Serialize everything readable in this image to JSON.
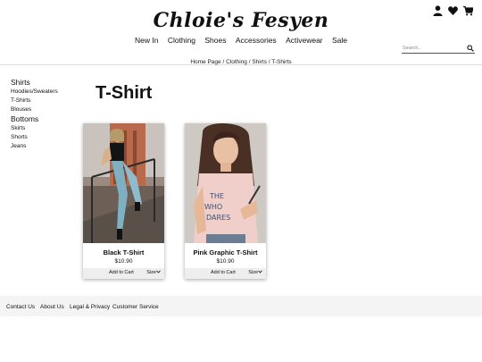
{
  "header": {
    "brand": "Chloie's Fesyen",
    "icons": [
      "user-icon",
      "heart-icon",
      "cart-icon"
    ]
  },
  "nav": {
    "items": [
      "New In",
      "Clothing",
      "Shoes",
      "Accessories",
      "Activewear",
      "Sale"
    ]
  },
  "search": {
    "placeholder": "Search..",
    "icon": "search-icon"
  },
  "breadcrumb": "Home Page / Clothing / Shirts / T-Shirts",
  "sidebar": {
    "groups": [
      {
        "title": "Shirts",
        "items": [
          "Hoodies/Sweaters",
          "T-Shirts",
          "Blouses"
        ]
      },
      {
        "title": "Bottoms",
        "items": [
          "Skirts",
          "Shorts",
          "Jeans"
        ]
      }
    ]
  },
  "page": {
    "title": "T-Shirt"
  },
  "products": [
    {
      "name": "Black T-Shirt",
      "price": "$10.90",
      "add_label": "Add to Cart",
      "size_label": "Size"
    },
    {
      "name": "Pink Graphic T-Shirt",
      "price": "$10.90",
      "add_label": "Add to Cart",
      "size_label": "Size"
    }
  ],
  "footer": {
    "links": [
      "Contact Us",
      "About Us",
      "Legal & Privacy",
      "Customer Service"
    ]
  }
}
